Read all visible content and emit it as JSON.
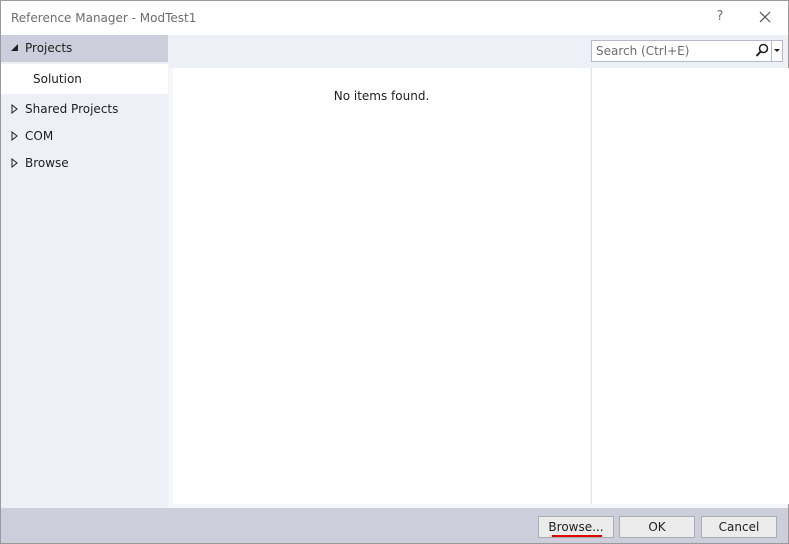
{
  "window": {
    "title": "Reference Manager - ModTest1",
    "help_label": "?"
  },
  "sidebar": {
    "items": [
      {
        "label": "Projects",
        "expanded": true,
        "selected": true
      },
      {
        "label": "Solution",
        "child": true,
        "active": true
      },
      {
        "label": "Shared Projects",
        "expanded": false
      },
      {
        "label": "COM",
        "expanded": false
      },
      {
        "label": "Browse",
        "expanded": false
      }
    ]
  },
  "search": {
    "placeholder": "Search (Ctrl+E)",
    "value": ""
  },
  "list": {
    "empty_message": "No items found."
  },
  "footer": {
    "browse_label": "Browse...",
    "ok_label": "OK",
    "cancel_label": "Cancel"
  },
  "colors": {
    "nav_background": "#eef0f7",
    "nav_selected": "#cccedb",
    "footer_background": "#cccedb",
    "highlight_underline": "#e00000"
  },
  "icons": {
    "help": "question-mark-icon",
    "close": "close-icon",
    "expanded": "triangle-expanded-icon",
    "collapsed": "triangle-collapsed-icon",
    "search": "search-icon",
    "dropdown": "chevron-down-icon"
  }
}
